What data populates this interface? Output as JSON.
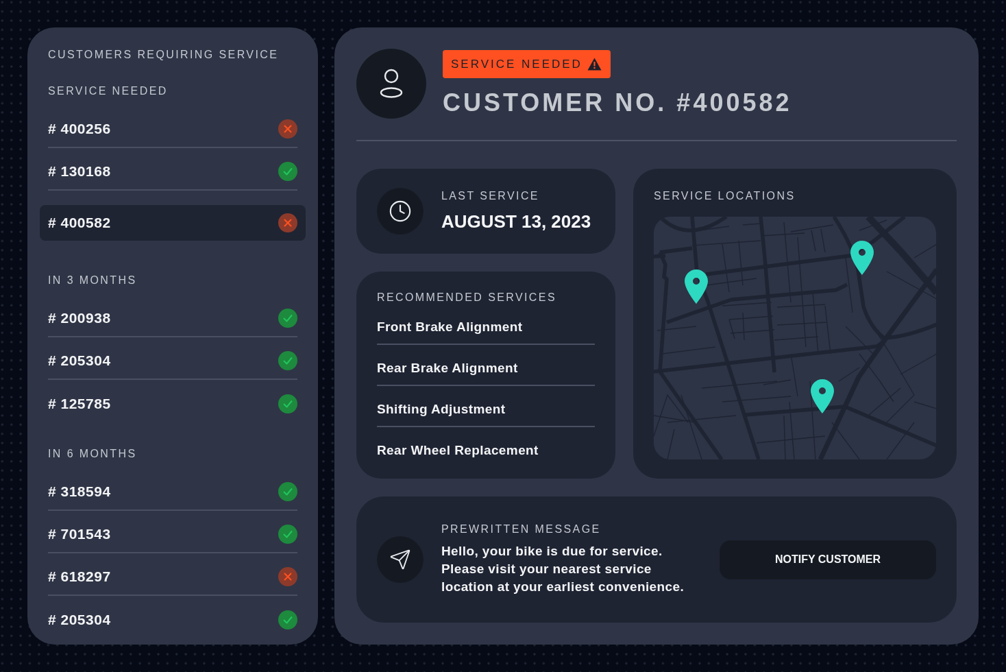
{
  "customers_panel": {
    "title": "CUSTOMERS REQUIRING SERVICE",
    "groups": [
      {
        "title": "SERVICE NEEDED",
        "customers": [
          {
            "number": "# 400256",
            "ok": false,
            "selected": false
          },
          {
            "number": "# 130168",
            "ok": true,
            "selected": false
          },
          {
            "number": "# 400582",
            "ok": false,
            "selected": true
          }
        ]
      },
      {
        "title": "IN 3 MONTHS",
        "customers": [
          {
            "number": "# 200938",
            "ok": true,
            "selected": false
          },
          {
            "number": "# 205304",
            "ok": true,
            "selected": false
          },
          {
            "number": "# 125785",
            "ok": true,
            "selected": false
          }
        ]
      },
      {
        "title": "IN 6 MONTHS",
        "customers": [
          {
            "number": "# 318594",
            "ok": true,
            "selected": false
          },
          {
            "number": "# 701543",
            "ok": true,
            "selected": false
          },
          {
            "number": "# 618297",
            "ok": false,
            "selected": false
          },
          {
            "number": "# 205304",
            "ok": true,
            "selected": false
          }
        ]
      }
    ]
  },
  "customer": {
    "badge": "SERVICE NEEDED",
    "title": "CUSTOMER NO. #400582"
  },
  "last_service": {
    "label": "LAST SERVICE",
    "date": "AUGUST 13, 2023"
  },
  "recommended_services": {
    "title": "RECOMMENDED SERVICES",
    "items": [
      "Front Brake Alignment",
      "Rear Brake Alignment",
      "Shifting Adjustment",
      "Rear Wheel Replacement"
    ]
  },
  "service_locations": {
    "title": "SERVICE LOCATIONS"
  },
  "prewritten_message": {
    "label": "PREWRITTEN MESSAGE",
    "text": "Hello, your bike is due for service.\nPlease visit your nearest service\nlocation at your earliest convenience.",
    "button": "NOTIFY CUSTOMER"
  }
}
